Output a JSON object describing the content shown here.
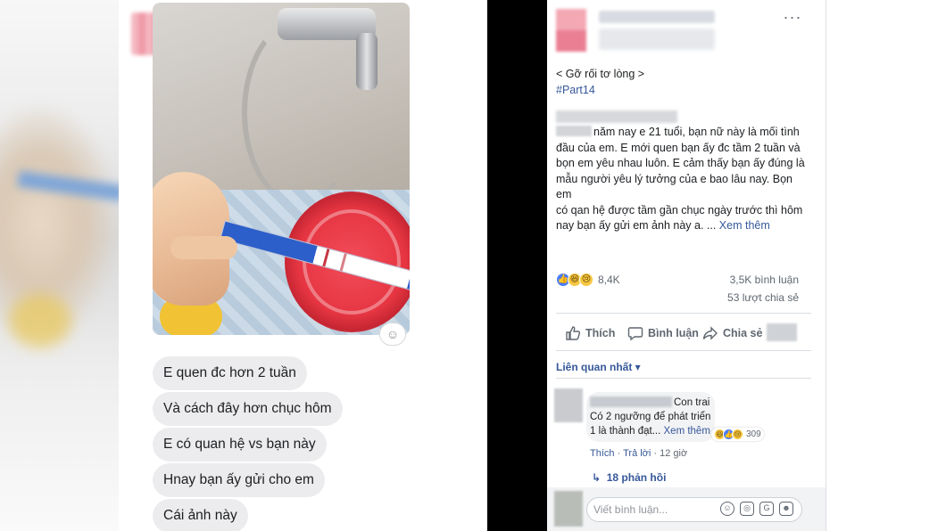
{
  "chat": {
    "messages": [
      "E quen đc hơn 2 tuần",
      "Và cách đây hơn chục hôm",
      "E có quan hệ vs bạn này",
      "Hnay bạn ấy gửi cho em",
      "Cái ảnh này"
    ],
    "react_icon": "add-reaction-icon"
  },
  "post": {
    "title_line": "< Gỡ rối tơ lòng >",
    "hashtag": "#Part14",
    "body": {
      "l1": "năm nay e 21 tuổi, bạn nữ này là mối tình",
      "l2": "đầu của em. E mới quen bạn ấy đc tầm 2 tuần và",
      "l3": "bọn em yêu nhau luôn. E cảm thấy bạn ấy đúng là",
      "l4": "mẫu người yêu lý tưởng của e bao lâu nay. Bọn em",
      "l5": "có qan hệ được tầm gần chục ngày trước thì hôm",
      "l6": "nay bạn ấy gửi em ảnh này a. ...",
      "see_more": "Xem thêm"
    },
    "reaction_count": "8,4K",
    "comments_count": "3,5K bình luận",
    "shares_count": "53 lượt chia sẻ",
    "actions": {
      "like": "Thích",
      "comment": "Bình luận",
      "share": "Chia sẻ"
    },
    "related_label": "Liên quan nhất ▾",
    "top_comment": {
      "first_words": "Con trai",
      "line2": "Có 2 ngưỡng để phát triển",
      "line3": "1 là thành đạt...",
      "see_more": "Xem thêm",
      "reaction_count": "309",
      "like": "Thích",
      "reply": "Trả lời",
      "time": "12 giờ"
    },
    "replies": "18 phản hồi",
    "composer_placeholder": "Viết bình luận..."
  },
  "colors": {
    "link": "#365899",
    "like_blue": "#4a7cf6",
    "bubble_gray": "#ececee",
    "divider": "#000000"
  }
}
